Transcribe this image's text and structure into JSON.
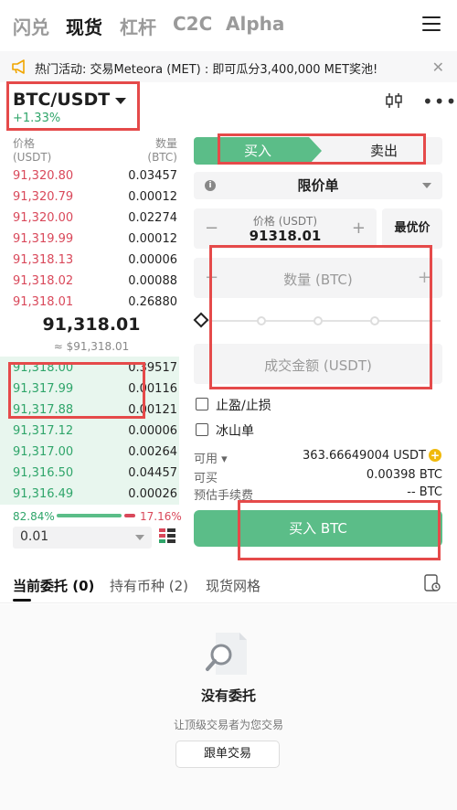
{
  "topnav": {
    "tabs": [
      "闪兑",
      "现货",
      "杠杆",
      "C2C",
      "Alpha"
    ],
    "active": 1
  },
  "announcement": {
    "text": "热门活动: 交易Meteora (MET) : 即可瓜分3,400,000 MET奖池!"
  },
  "pair": {
    "name": "BTC/USDT",
    "change": "+1.33%"
  },
  "orderbook": {
    "price_header": "价格",
    "price_unit": "(USDT)",
    "qty_header": "数量",
    "qty_unit": "(BTC)",
    "asks": [
      {
        "price": "91,320.80",
        "qty": "0.03457"
      },
      {
        "price": "91,320.79",
        "qty": "0.00012"
      },
      {
        "price": "91,320.00",
        "qty": "0.02274"
      },
      {
        "price": "91,319.99",
        "qty": "0.00012"
      },
      {
        "price": "91,318.13",
        "qty": "0.00006"
      },
      {
        "price": "91,318.02",
        "qty": "0.00088"
      },
      {
        "price": "91,318.01",
        "qty": "0.26880"
      }
    ],
    "last_price": "91,318.01",
    "last_price_fiat": "≈ $91,318.01",
    "bids": [
      {
        "price": "91,318.00",
        "qty": "0.39517"
      },
      {
        "price": "91,317.99",
        "qty": "0.00116"
      },
      {
        "price": "91,317.88",
        "qty": "0.00121"
      },
      {
        "price": "91,317.12",
        "qty": "0.00006"
      },
      {
        "price": "91,317.00",
        "qty": "0.00264"
      },
      {
        "price": "91,316.50",
        "qty": "0.04457"
      },
      {
        "price": "91,316.49",
        "qty": "0.00026"
      }
    ],
    "buy_ratio": "82.84%",
    "sell_ratio": "17.16%",
    "buy_ratio_value": 0.8284,
    "precision": "0.01"
  },
  "form": {
    "buy_tab": "买入",
    "sell_tab": "卖出",
    "order_type": "限价单",
    "price_label": "价格 (USDT)",
    "price_value": "91318.01",
    "best_price": "最优价",
    "qty_placeholder": "数量 (BTC)",
    "amount_placeholder": "成交金额 (USDT)",
    "tp_sl": "止盈/止损",
    "iceberg": "冰山单",
    "available_label": "可用",
    "available_value": "363.66649004 USDT",
    "can_buy_label": "可买",
    "can_buy_value": "0.00398 BTC",
    "fee_label": "预估手续费",
    "fee_value": "-- BTC",
    "submit": "买入 BTC"
  },
  "bottom": {
    "tabs": [
      "当前委托 (0)",
      "持有币种 (2)",
      "现货网格"
    ],
    "empty_title": "没有委托",
    "empty_sub": "让顶级交易者为您交易",
    "copy_button": "跟单交易"
  },
  "colors": {
    "buy": "#5bbd88",
    "sell": "#d9485a",
    "highlight": "#e54a4a"
  }
}
